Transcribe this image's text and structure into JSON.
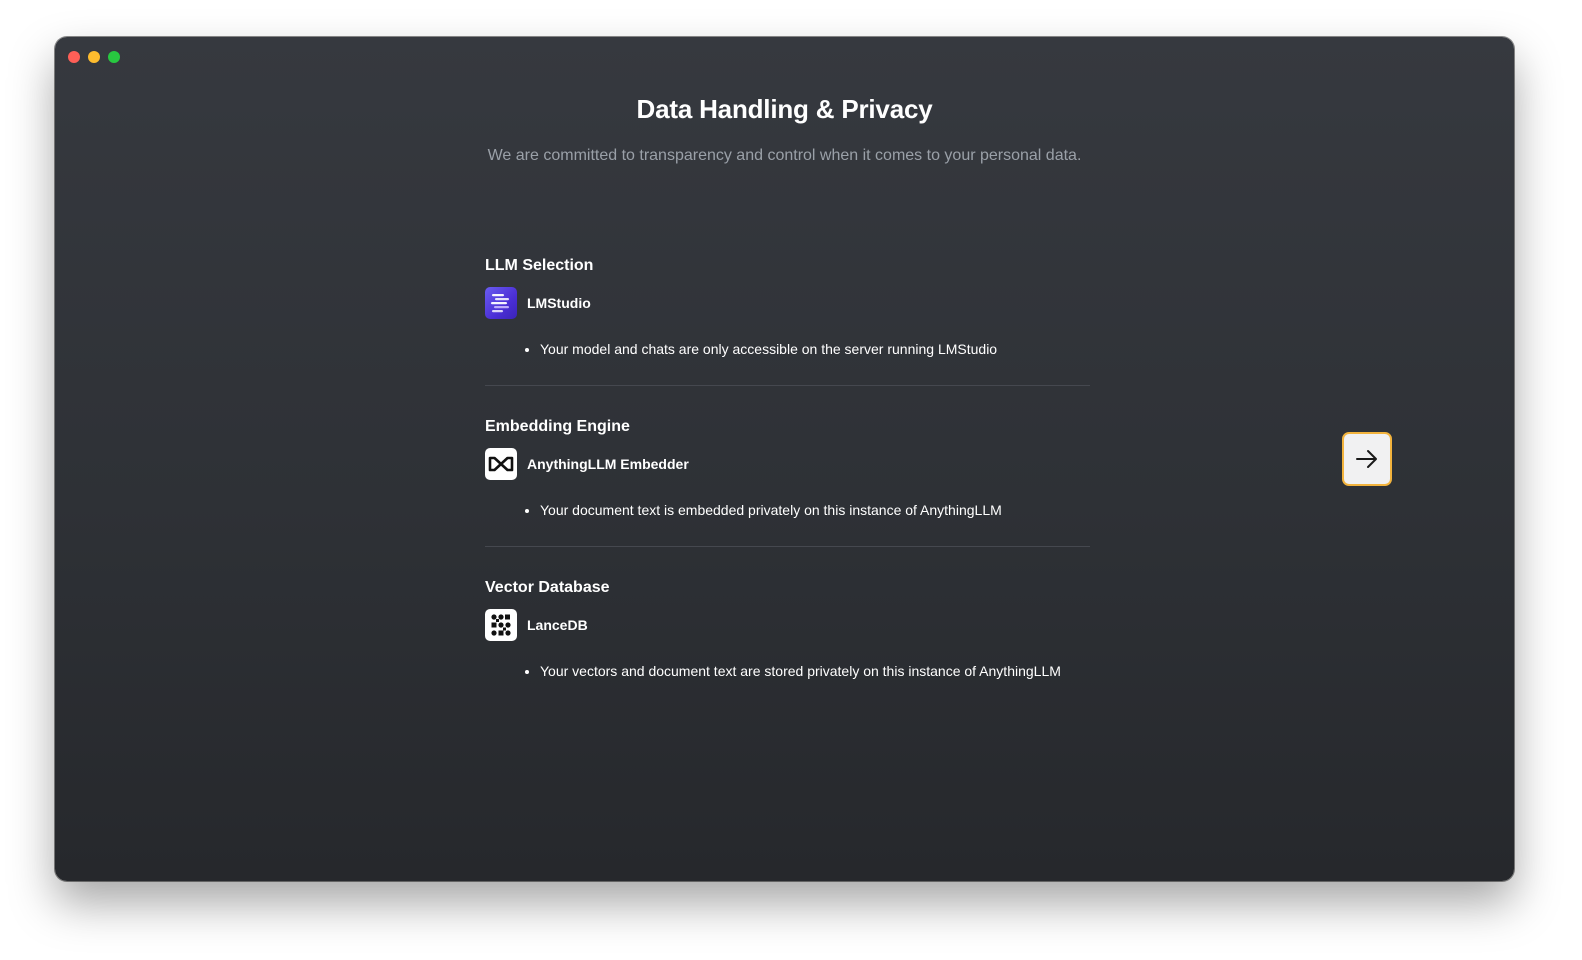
{
  "page": {
    "title": "Data Handling & Privacy",
    "subtitle": "We are committed to transparency and control when it comes to your personal data."
  },
  "window": {
    "traffic_lights": [
      "#fe5f57",
      "#febc2e",
      "#28c840"
    ]
  },
  "sections": [
    {
      "heading": "LLM Selection",
      "provider": "LMStudio",
      "icon": "lmstudio-logo-icon",
      "bullets": [
        "Your model and chats are only accessible on the server running LMStudio"
      ]
    },
    {
      "heading": "Embedding Engine",
      "provider": "AnythingLLM Embedder",
      "icon": "anythingllm-logo-icon",
      "bullets": [
        "Your document text is embedded privately on this instance of AnythingLLM"
      ]
    },
    {
      "heading": "Vector Database",
      "provider": "LanceDB",
      "icon": "lancedb-logo-icon",
      "bullets": [
        "Your vectors and document text are stored privately on this instance of AnythingLLM"
      ]
    }
  ],
  "next_button": {
    "icon": "arrow-right-icon",
    "border_color": "#f2b33d"
  }
}
